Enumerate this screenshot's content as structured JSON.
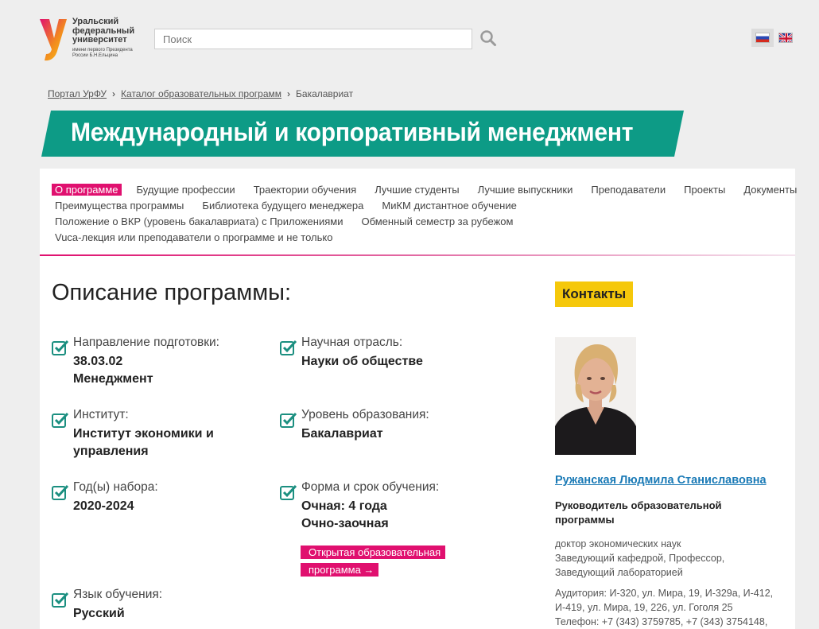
{
  "header": {
    "logo_name": "Уральский федеральный университет",
    "logo_sub": "имени первого Президента России Б.Н.Ельцина",
    "search_placeholder": "Поиск"
  },
  "breadcrumb": {
    "items": [
      "Портал УрФУ",
      "Каталог образовательных программ",
      "Бакалавриат"
    ]
  },
  "page_title": "Международный и корпоративный менеджмент",
  "tabs": {
    "row1": [
      "О программе",
      "Будущие профессии",
      "Траектории обучения",
      "Лучшие студенты",
      "Лучшие выпускники",
      "Преподаватели",
      "Проекты",
      "Документы"
    ],
    "row2": [
      "Преимущества программы",
      "Библиотека будущего менеджера",
      "МиКМ дистантное обучение"
    ],
    "row3": [
      "Положение о ВКР (уровень бакалавриата) с Приложениями",
      "Обменный семестр за рубежом"
    ],
    "row4": [
      "Vuca-лекция или преподаватели о программе и не только"
    ],
    "active": "О программе"
  },
  "description": {
    "title": "Описание программы:",
    "fields": [
      {
        "label": "Направление подготовки:",
        "value_lines": [
          "38.03.02",
          "Менеджмент"
        ]
      },
      {
        "label": "Научная отрасль:",
        "value_lines": [
          "Науки об обществе"
        ]
      },
      {
        "label": "Институт:",
        "value_lines": [
          "Институт экономики и",
          "управления"
        ]
      },
      {
        "label": "Уровень образования:",
        "value_lines": [
          "Бакалавриат"
        ]
      },
      {
        "label": "Год(ы) набора:",
        "value_lines": [
          "2020-2024"
        ]
      },
      {
        "label": "Форма и срок обучения:",
        "value_lines": [
          "Очная: 4 года",
          "Очно-заочная"
        ]
      },
      {
        "label": "Язык обучения:",
        "value_lines": [
          "Русский"
        ]
      }
    ],
    "open_program_link": "Открытая образовательная программа →"
  },
  "contacts": {
    "button": "Контакты",
    "name": "Ружанская Людмила Станиславовна",
    "role": "Руководитель образовательной программы",
    "degree_lines": [
      "доктор экономических наук",
      "Заведующий кафедрой, Профессор,",
      "Заведующий лабораторией"
    ],
    "address": "Аудитория: И-320, ул. Мира, 19, И-329а, И-412, И-419, ул. Мира, 19, 226, ул. Гоголя 25",
    "phone": "Телефон: +7 (343) 3759785, +7 (343) 3754148,"
  },
  "colors": {
    "brand_teal": "#0d9b86",
    "accent_pink": "#e0106f",
    "contacts_yellow": "#f5c80b",
    "link_blue": "#1a7ab6"
  }
}
